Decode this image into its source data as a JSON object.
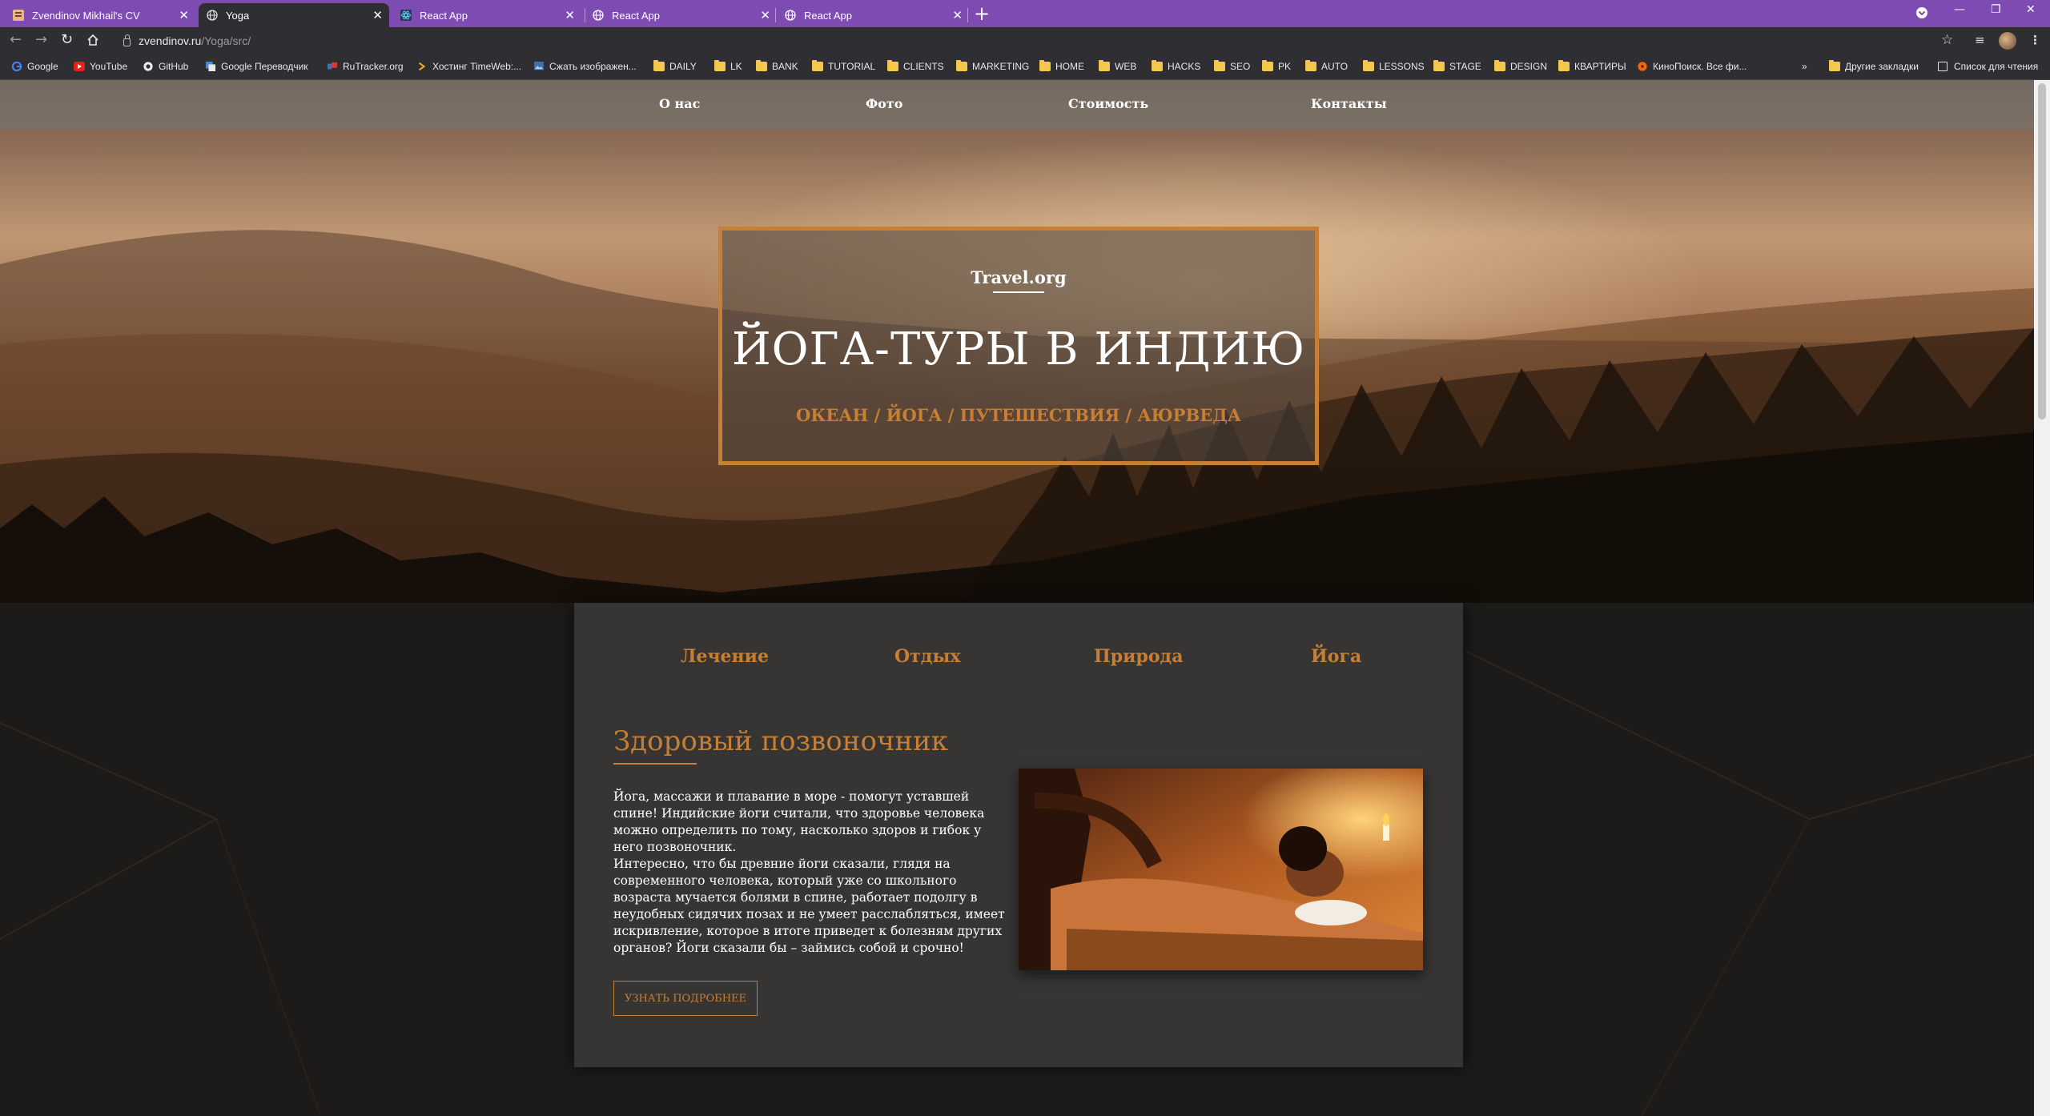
{
  "browser": {
    "tabs": [
      {
        "title": "Zvendinov Mikhail's CV",
        "active": false
      },
      {
        "title": "Yoga",
        "active": true
      },
      {
        "title": "React App",
        "active": false
      },
      {
        "title": "React App",
        "active": false
      },
      {
        "title": "React App",
        "active": false
      }
    ],
    "new_tab": "+",
    "address": {
      "host": "zvendinov.ru",
      "path": "/Yoga/src/"
    },
    "bookmarks": [
      {
        "label": "Google",
        "icon": "google-icon"
      },
      {
        "label": "YouTube",
        "icon": "youtube-icon"
      },
      {
        "label": "GitHub",
        "icon": "github-icon"
      },
      {
        "label": "Google Переводчик",
        "icon": "translate-icon"
      },
      {
        "label": "RuTracker.org",
        "icon": "rutracker-icon"
      },
      {
        "label": "Хостинг TimeWeb:...",
        "icon": "timeweb-icon"
      },
      {
        "label": "Сжать изображен...",
        "icon": "image-icon"
      },
      {
        "label": "DAILY",
        "icon": "folder-icon"
      },
      {
        "label": "LK",
        "icon": "folder-icon"
      },
      {
        "label": "BANK",
        "icon": "folder-icon"
      },
      {
        "label": "TUTORIAL",
        "icon": "folder-icon"
      },
      {
        "label": "CLIENTS",
        "icon": "folder-icon"
      },
      {
        "label": "MARKETING",
        "icon": "folder-icon"
      },
      {
        "label": "HOME",
        "icon": "folder-icon"
      },
      {
        "label": "WEB",
        "icon": "folder-icon"
      },
      {
        "label": "HACKS",
        "icon": "folder-icon"
      },
      {
        "label": "SEO",
        "icon": "folder-icon"
      },
      {
        "label": "PK",
        "icon": "folder-icon"
      },
      {
        "label": "AUTO",
        "icon": "folder-icon"
      },
      {
        "label": "LESSONS",
        "icon": "folder-icon"
      },
      {
        "label": "STAGE",
        "icon": "folder-icon"
      },
      {
        "label": "DESIGN",
        "icon": "folder-icon"
      },
      {
        "label": "КВАРТИРЫ",
        "icon": "folder-icon"
      },
      {
        "label": "КиноПоиск. Все фи...",
        "icon": "kinopoisk-icon"
      }
    ],
    "more_bookmarks": "»",
    "other_bookmarks": "Другие закладки",
    "reading_list": "Список для чтения"
  },
  "site": {
    "nav": [
      "О нас",
      "Фото",
      "Стоимость",
      "Контакты"
    ],
    "hero": {
      "brand": "Travel.org",
      "title": "ЙОГА-ТУРЫ В ИНДИЮ",
      "subtitle": "ОКЕАН / ЙОГА / ПУТЕШЕСТВИЯ / АЮРВЕДА"
    },
    "card": {
      "tabs": [
        "Лечение",
        "Отдых",
        "Природа",
        "Йога"
      ],
      "title": "Здоровый позвоночник",
      "paragraph1": "Йога, массажи и плавание в море - помогут уставшей спине! Индийские йоги считали, что здоровье человека можно определить по тому, насколько здоров и гибок у него позвоночник.",
      "paragraph2": "Интересно, что бы древние йоги сказали, глядя на современного человека, который уже со школьного возраста мучается болями в спине, работает подолгу в неудобных сидячих позах и не умеет расслабляться, имеет искривление, которое в итоге приведет к болезням других органов? Йоги сказали бы – займись собой и срочно!",
      "button": "УЗНАТЬ ПОДРОБНЕЕ"
    }
  },
  "colors": {
    "tabstrip": "#7e4bb3",
    "accent": "#c67f35",
    "card": "#373533",
    "page_bg": "#1c1b1a"
  }
}
